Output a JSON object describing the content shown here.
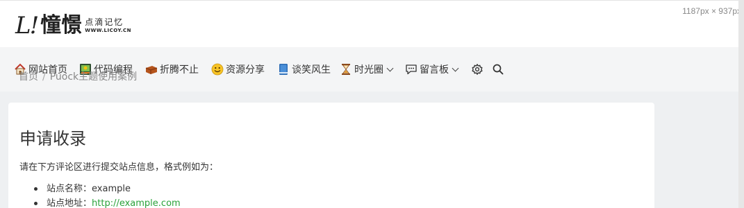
{
  "logo": {
    "script": "L!",
    "main": "憧憬",
    "sub": "点滴记忆",
    "url": "WWW.LICOY.CN"
  },
  "dimension_overlay": "1187px × 937px",
  "nav": {
    "items": [
      {
        "label": "网站首页",
        "icon": "home-icon"
      },
      {
        "label": "代码编程",
        "icon": "code-icon"
      },
      {
        "label": "折腾不止",
        "icon": "brick-icon"
      },
      {
        "label": "资源分享",
        "icon": "smiley-icon"
      },
      {
        "label": "谈笑风生",
        "icon": "book-icon"
      },
      {
        "label": "时光圈",
        "icon": "hourglass-icon",
        "dropdown": true
      },
      {
        "label": "留言板",
        "icon": "chat-icon",
        "dropdown": true
      }
    ],
    "settings_icon": "gear-icon",
    "search_icon": "search-icon"
  },
  "breadcrumb": {
    "home": "首页",
    "separator": "/",
    "current": "Puock主题使用案例"
  },
  "article": {
    "title": "申请收录",
    "intro": "请在下方评论区进行提交站点信息，格式例如为：",
    "fields": [
      {
        "label": "站点名称：",
        "value": "example",
        "is_link": false
      },
      {
        "label": "站点地址：",
        "value": "http://example.com",
        "is_link": true
      }
    ]
  },
  "colors": {
    "link": "#2aa23a",
    "nav_bg": "#f4f5f6",
    "page_bg": "#eef0f2"
  }
}
